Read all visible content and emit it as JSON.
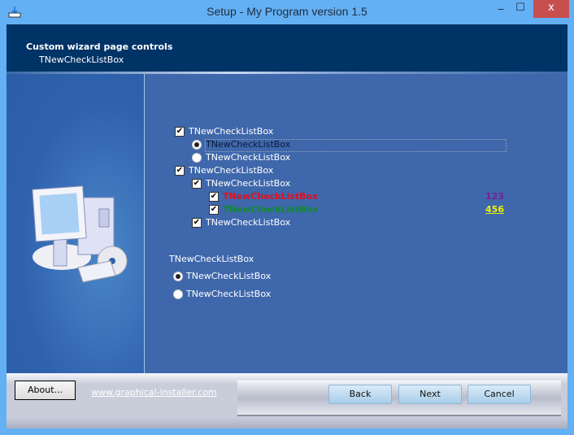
{
  "window": {
    "title": "Setup - My Program version 1.5",
    "minimize": "‒",
    "maximize": "☐",
    "close": "x"
  },
  "header": {
    "title": "Custom wizard page controls",
    "subtitle": "TNewCheckListBox"
  },
  "checklist": [
    {
      "label": "TNewCheckListBox",
      "type": "checkbox",
      "checked": true
    },
    {
      "label": "TNewCheckListBox",
      "type": "radio",
      "checked": true,
      "focused": true
    },
    {
      "label": "TNewCheckListBox",
      "type": "radio",
      "checked": false
    },
    {
      "label": "TNewCheckListBox",
      "type": "checkbox",
      "checked": true
    },
    {
      "label": "TNewCheckListBox",
      "type": "checkbox",
      "checked": true
    },
    {
      "label": "TNewCheckListBox",
      "type": "checkbox",
      "checked": true,
      "color": "#e0101e",
      "subvalue": "123",
      "subcolor": "#7a1f9a"
    },
    {
      "label": "TNewCheckListBox",
      "type": "checkbox",
      "checked": true,
      "color": "#108a30",
      "subvalue": "456",
      "subcolor": "#f0f000"
    },
    {
      "label": "TNewCheckListBox",
      "type": "checkbox",
      "checked": true
    }
  ],
  "radiogroup": {
    "label": "TNewCheckListBox",
    "options": [
      {
        "label": "TNewCheckListBox",
        "checked": true
      },
      {
        "label": "TNewCheckListBox",
        "checked": false
      }
    ]
  },
  "footer": {
    "about": "About...",
    "link": "www.graphical-installer.com",
    "back": "Back",
    "next": "Next",
    "cancel": "Cancel"
  }
}
